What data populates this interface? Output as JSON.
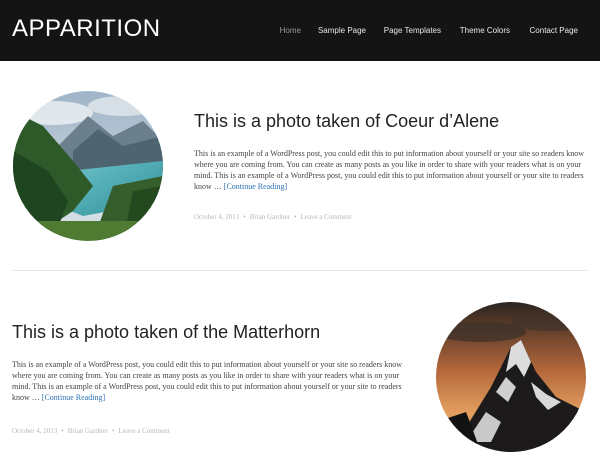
{
  "site": {
    "title": "APPARITION"
  },
  "nav": {
    "items": [
      {
        "label": "Home",
        "active": true
      },
      {
        "label": "Sample Page",
        "active": false
      },
      {
        "label": "Page Templates",
        "active": false
      },
      {
        "label": "Theme Colors",
        "active": false
      },
      {
        "label": "Contact Page",
        "active": false
      }
    ]
  },
  "posts": [
    {
      "title": "This is a photo taken of Coeur d’Alene",
      "excerpt": "This is an example of a WordPress post, you could edit this to put information about yourself or your site so readers know where you are coming from. You can create as many posts as you like in order to share with your readers what is on your mind. This is an example of a WordPress post, you could edit this to put information about yourself or your site to readers know … ",
      "more": "[Continue Reading]",
      "date": "October 4, 2013",
      "author": "Brian Gardner",
      "comments": "Leave a Comment",
      "image": "lake-landscape-photo"
    },
    {
      "title": "This is a photo taken of the Matterhorn",
      "excerpt": "This is an example of a WordPress post, you could edit this to put information about yourself or your site so readers know where you are coming from. You can create as many posts as you like in order to share with your readers what is on your mind. This is an example of a WordPress post, you could edit this to put information about yourself or your site to readers know … ",
      "more": "[Continue Reading]",
      "date": "October 4, 2013",
      "author": "Brian Gardner",
      "comments": "Leave a Comment",
      "image": "mountain-photo"
    }
  ],
  "colors": {
    "header_bg": "#141414",
    "link": "#2a6fb3"
  }
}
